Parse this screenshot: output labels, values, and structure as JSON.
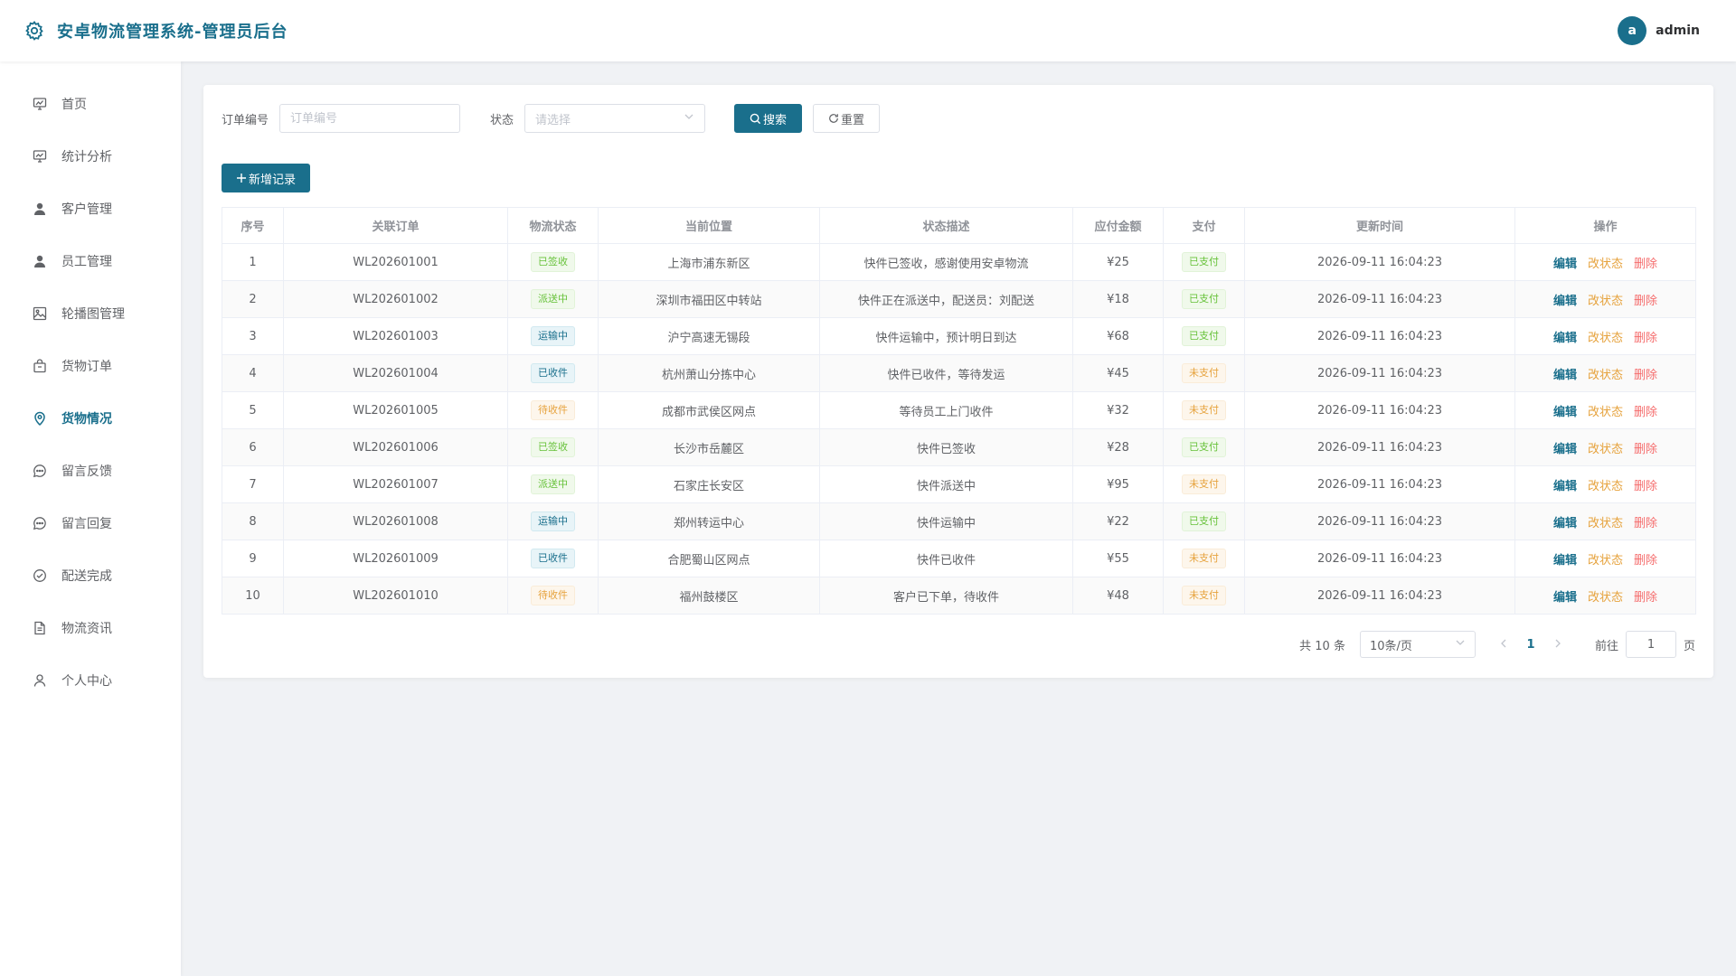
{
  "header": {
    "title": "安卓物流管理系统-管理员后台",
    "avatar_letter": "a",
    "username": "admin"
  },
  "sidebar": {
    "items": [
      {
        "label": "首页",
        "icon": "dashboard-icon"
      },
      {
        "label": "统计分析",
        "icon": "chart-icon"
      },
      {
        "label": "客户管理",
        "icon": "user-icon"
      },
      {
        "label": "员工管理",
        "icon": "user-icon"
      },
      {
        "label": "轮播图管理",
        "icon": "image-icon"
      },
      {
        "label": "货物订单",
        "icon": "bag-icon"
      },
      {
        "label": "货物情况",
        "icon": "location-icon",
        "active": true
      },
      {
        "label": "留言反馈",
        "icon": "chat-icon"
      },
      {
        "label": "留言回复",
        "icon": "chat-icon"
      },
      {
        "label": "配送完成",
        "icon": "check-circle-icon"
      },
      {
        "label": "物流资讯",
        "icon": "document-icon"
      },
      {
        "label": "个人中心",
        "icon": "person-icon"
      }
    ]
  },
  "search": {
    "order_label": "订单编号",
    "order_placeholder": "订单编号",
    "status_label": "状态",
    "status_placeholder": "请选择",
    "search_btn": "搜索",
    "reset_btn": "重置"
  },
  "add_btn": "新增记录",
  "table": {
    "columns": [
      "序号",
      "关联订单",
      "物流状态",
      "当前位置",
      "状态描述",
      "应付金额",
      "支付",
      "更新时间",
      "操作"
    ],
    "actions": {
      "edit": "编辑",
      "status": "改状态",
      "delete": "删除"
    },
    "rows": [
      {
        "idx": "1",
        "order": "WL202601001",
        "status": "已签收",
        "status_type": "green",
        "location": "上海市浦东新区",
        "desc": "快件已签收，感谢使用安卓物流",
        "amount": "¥25",
        "pay": "已支付",
        "pay_type": "green",
        "time": "2026-09-11 16:04:23"
      },
      {
        "idx": "2",
        "order": "WL202601002",
        "status": "派送中",
        "status_type": "green",
        "location": "深圳市福田区中转站",
        "desc": "快件正在派送中，配送员：刘配送",
        "amount": "¥18",
        "pay": "已支付",
        "pay_type": "green",
        "time": "2026-09-11 16:04:23"
      },
      {
        "idx": "3",
        "order": "WL202601003",
        "status": "运输中",
        "status_type": "blue",
        "location": "沪宁高速无锡段",
        "desc": "快件运输中，预计明日到达",
        "amount": "¥68",
        "pay": "已支付",
        "pay_type": "green",
        "time": "2026-09-11 16:04:23"
      },
      {
        "idx": "4",
        "order": "WL202601004",
        "status": "已收件",
        "status_type": "blue",
        "location": "杭州萧山分拣中心",
        "desc": "快件已收件，等待发运",
        "amount": "¥45",
        "pay": "未支付",
        "pay_type": "orange",
        "time": "2026-09-11 16:04:23"
      },
      {
        "idx": "5",
        "order": "WL202601005",
        "status": "待收件",
        "status_type": "orange",
        "location": "成都市武侯区网点",
        "desc": "等待员工上门收件",
        "amount": "¥32",
        "pay": "未支付",
        "pay_type": "orange",
        "time": "2026-09-11 16:04:23"
      },
      {
        "idx": "6",
        "order": "WL202601006",
        "status": "已签收",
        "status_type": "green",
        "location": "长沙市岳麓区",
        "desc": "快件已签收",
        "amount": "¥28",
        "pay": "已支付",
        "pay_type": "green",
        "time": "2026-09-11 16:04:23"
      },
      {
        "idx": "7",
        "order": "WL202601007",
        "status": "派送中",
        "status_type": "green",
        "location": "石家庄长安区",
        "desc": "快件派送中",
        "amount": "¥95",
        "pay": "未支付",
        "pay_type": "orange",
        "time": "2026-09-11 16:04:23"
      },
      {
        "idx": "8",
        "order": "WL202601008",
        "status": "运输中",
        "status_type": "blue",
        "location": "郑州转运中心",
        "desc": "快件运输中",
        "amount": "¥22",
        "pay": "已支付",
        "pay_type": "green",
        "time": "2026-09-11 16:04:23"
      },
      {
        "idx": "9",
        "order": "WL202601009",
        "status": "已收件",
        "status_type": "blue",
        "location": "合肥蜀山区网点",
        "desc": "快件已收件",
        "amount": "¥55",
        "pay": "未支付",
        "pay_type": "orange",
        "time": "2026-09-11 16:04:23"
      },
      {
        "idx": "10",
        "order": "WL202601010",
        "status": "待收件",
        "status_type": "orange",
        "location": "福州鼓楼区",
        "desc": "客户已下单，待收件",
        "amount": "¥48",
        "pay": "未支付",
        "pay_type": "orange",
        "time": "2026-09-11 16:04:23"
      }
    ]
  },
  "pagination": {
    "total_text": "共 10 条",
    "page_size": "10条/页",
    "current_page": "1",
    "goto_label": "前往",
    "goto_value": "1",
    "page_suffix": "页"
  },
  "colors": {
    "primary": "#1a6f8c",
    "success": "#67c23a",
    "warning": "#e6a23c",
    "danger": "#f56c6c"
  }
}
